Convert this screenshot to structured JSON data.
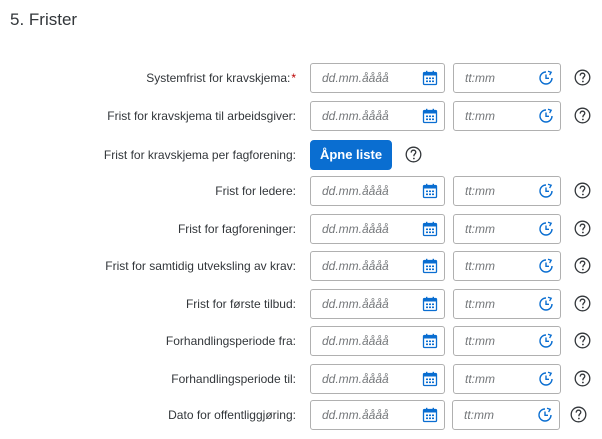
{
  "section": {
    "title": "5. Frister"
  },
  "placeholders": {
    "date": "dd.mm.åååå",
    "time": "tt:mm"
  },
  "rows": [
    {
      "label": "Systemfrist for kravskjema:",
      "required": true,
      "type": "datetime"
    },
    {
      "label": "Frist for kravskjema til arbeidsgiver:",
      "required": false,
      "type": "datetime"
    },
    {
      "label": "Frist for kravskjema per fagforening:",
      "required": false,
      "type": "button",
      "button_label": "Åpne liste"
    },
    {
      "label": "Frist for ledere:",
      "required": false,
      "type": "datetime"
    },
    {
      "label": "Frist for fagforeninger:",
      "required": false,
      "type": "datetime"
    },
    {
      "label": "Frist for samtidig utveksling av krav:",
      "required": false,
      "type": "datetime"
    },
    {
      "label": "Frist for første tilbud:",
      "required": false,
      "type": "datetime"
    },
    {
      "label": "Forhandlingsperiode fra:",
      "required": false,
      "type": "datetime"
    },
    {
      "label": "Forhandlingsperiode til:",
      "required": false,
      "type": "datetime"
    },
    {
      "label": "Dato for offentliggjøring:",
      "required": false,
      "type": "datetime"
    }
  ],
  "required_marker": "*",
  "icons": {
    "date": "calendar-icon",
    "time": "clock-icon",
    "help": "help-icon"
  },
  "colors": {
    "accent": "#0a6ed1",
    "required": "#bb0000",
    "text": "#32363a",
    "placeholder": "#74777a",
    "border": "#b0b0b0"
  }
}
